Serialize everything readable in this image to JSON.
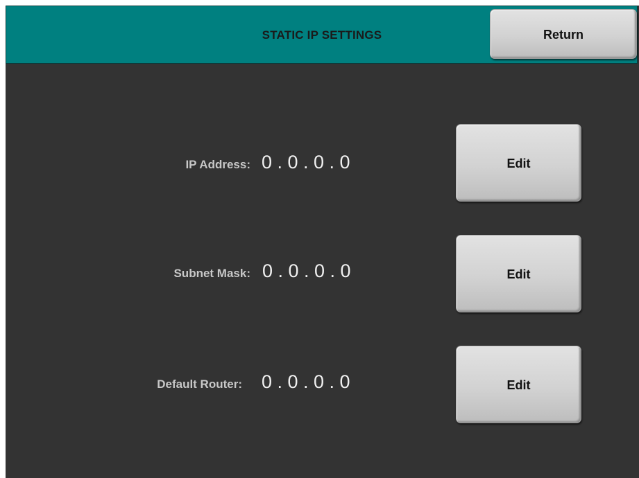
{
  "header": {
    "title": "STATIC IP SETTINGS",
    "return_label": "Return"
  },
  "rows": [
    {
      "label": "IP Address:",
      "value": "0 . 0 . 0 . 0",
      "edit_label": "Edit"
    },
    {
      "label": "Subnet Mask:",
      "value": "0 . 0 . 0 . 0",
      "edit_label": "Edit"
    },
    {
      "label": "Default Router:",
      "value": "0 . 0 . 0 . 0",
      "edit_label": "Edit"
    }
  ],
  "colors": {
    "header_bg": "#008080",
    "panel_bg": "#333333",
    "button_face": "#d2d2d2"
  }
}
